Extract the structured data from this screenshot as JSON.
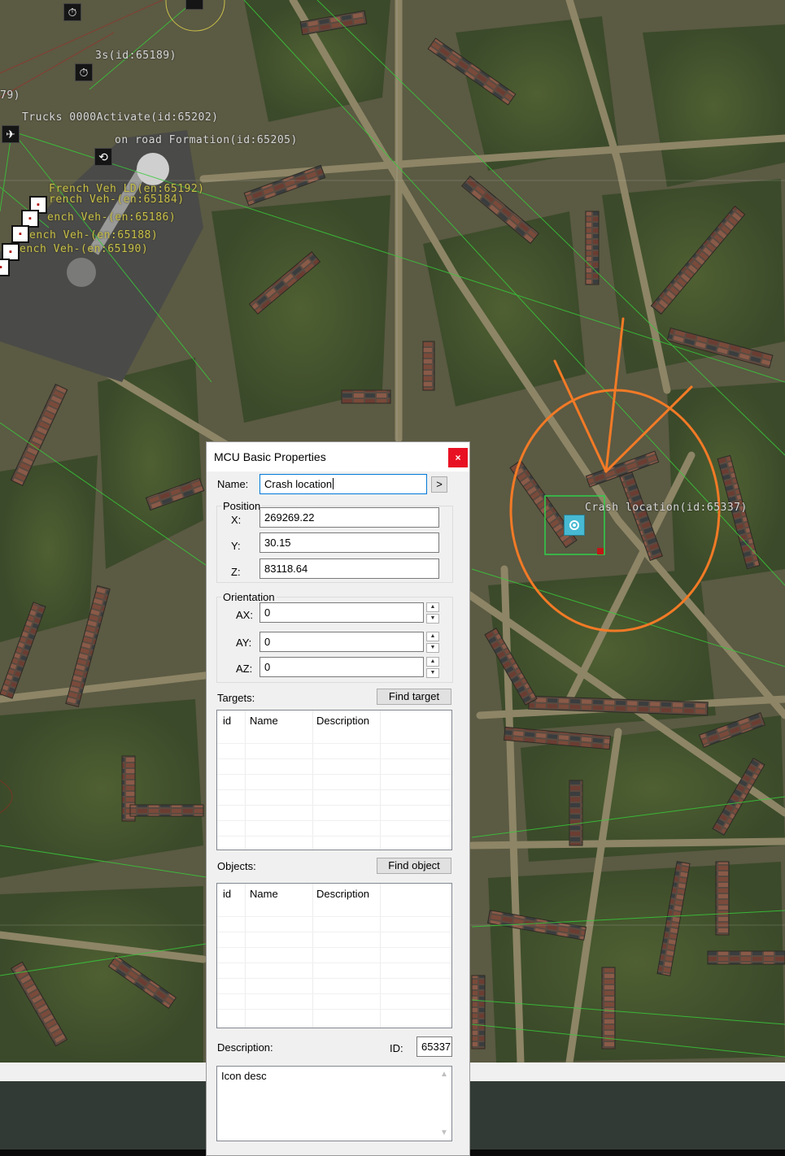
{
  "map": {
    "labels": [
      {
        "text": "3s(id:65189)",
        "style": "white"
      },
      {
        "text": "Trucks 0000Activate(id:65202)",
        "style": "white"
      },
      {
        "text": "on road Formation(id:65205)",
        "style": "white"
      },
      {
        "text": "French Veh LD(en:65192)",
        "style": "yellow"
      },
      {
        "text": "rench Veh-(en:65184)",
        "style": "yellow"
      },
      {
        "text": "ench Veh-(en:65186)",
        "style": "yellow"
      },
      {
        "text": "ench Veh-(en:65188)",
        "style": "yellow"
      },
      {
        "text": "ench Veh-(en:65190)",
        "style": "yellow"
      },
      {
        "text": "79)",
        "style": "white"
      },
      {
        "text": "Crash location(id:65337)",
        "style": "white"
      }
    ],
    "icons": [
      "timer-icon",
      "timer-icon",
      "formation-icon",
      "plane-icon",
      "target-marker-icon"
    ],
    "colors": {
      "annotation": "#f27a26",
      "link_line": "#38c83a",
      "selection": "#2fd04a",
      "marker": "#47b9d2"
    }
  },
  "dialog": {
    "title": "MCU Basic Properties",
    "close": "×",
    "name_label": "Name:",
    "name_value": "Crash location",
    "name_button": ">",
    "position": {
      "title": "Position",
      "x_label": "X:",
      "x_value": "269269.22",
      "y_label": "Y:",
      "y_value": "30.15",
      "z_label": "Z:",
      "z_value": "83118.64"
    },
    "orientation": {
      "title": "Orientation",
      "ax_label": "AX:",
      "ax_value": "0",
      "ay_label": "AY:",
      "ay_value": "0",
      "az_label": "AZ:",
      "az_value": "0"
    },
    "spin_up": "▲",
    "spin_down": "▼",
    "targets": {
      "label": "Targets:",
      "button": "Find target",
      "columns": [
        "id",
        "Name",
        "Description"
      ]
    },
    "objects": {
      "label": "Objects:",
      "button": "Find object",
      "columns": [
        "id",
        "Name",
        "Description"
      ]
    },
    "description_label": "Description:",
    "id_label": "ID:",
    "id_value": "65337",
    "description_value": "Icon desc",
    "scroll_up": "▲",
    "scroll_down": "▼"
  }
}
